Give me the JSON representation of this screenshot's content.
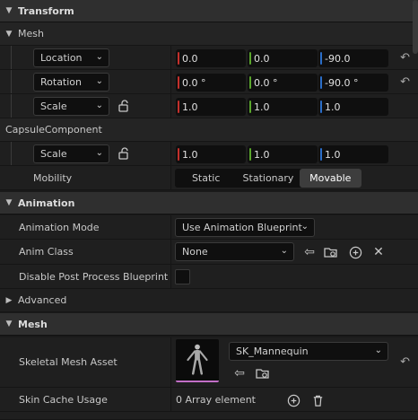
{
  "transform": {
    "category": "Transform",
    "mesh_section": "Mesh",
    "location": {
      "label": "Location",
      "x": "0.0",
      "y": "0.0",
      "z": "-90.0"
    },
    "rotation": {
      "label": "Rotation",
      "x": "0.0 °",
      "y": "0.0 °",
      "z": "-90.0 °"
    },
    "scale": {
      "label": "Scale",
      "x": "1.0",
      "y": "1.0",
      "z": "1.0"
    },
    "capsule_section": "CapsuleComponent",
    "capsule_scale": {
      "label": "Scale",
      "x": "1.0",
      "y": "1.0",
      "z": "1.0"
    },
    "mobility": {
      "label": "Mobility",
      "options": [
        "Static",
        "Stationary",
        "Movable"
      ],
      "selected": "Movable"
    }
  },
  "animation": {
    "category": "Animation",
    "mode": {
      "label": "Animation Mode",
      "value": "Use Animation Blueprint"
    },
    "anim_class": {
      "label": "Anim Class",
      "value": "None"
    },
    "disable_post_process": {
      "label": "Disable Post Process Blueprint",
      "checked": false
    },
    "advanced": "Advanced"
  },
  "mesh": {
    "category": "Mesh",
    "skeletal_mesh_asset": {
      "label": "Skeletal Mesh Asset",
      "value": "SK_Mannequin"
    },
    "skin_cache_usage": {
      "label": "Skin Cache Usage",
      "value": "0 Array element"
    }
  },
  "colors": {
    "x_axis": "#c4302b",
    "y_axis": "#5aa62c",
    "z_axis": "#2b6ec9",
    "thumbnail_accent": "#c26fc7"
  }
}
